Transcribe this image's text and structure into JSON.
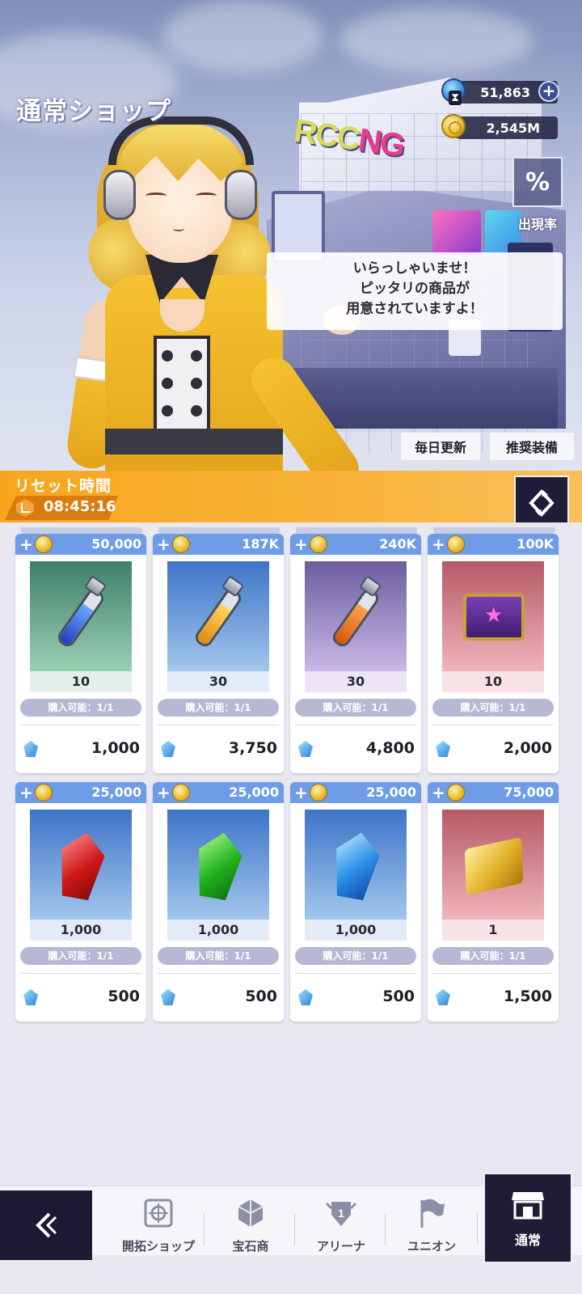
{
  "header": {
    "title": "通常ショップ",
    "gems": "51,863",
    "gold": "2,545M",
    "rate_icon": "%",
    "rate_label": "出現率",
    "speech": [
      "いらっしゃいませ！",
      "ピッタリの商品が",
      "用意されていますよ！"
    ],
    "tabs": [
      "毎日更新",
      "推奨装備"
    ]
  },
  "reset": {
    "label": "リセット時間",
    "time": "08:45:16"
  },
  "items": [
    {
      "top_price": "50,000",
      "qty": "10",
      "limit": "購入可能：1/1",
      "price": "1,000",
      "art": "vial-blue"
    },
    {
      "top_price": "187K",
      "qty": "30",
      "limit": "購入可能：1/1",
      "price": "3,750",
      "art": "vial-yellow"
    },
    {
      "top_price": "240K",
      "qty": "30",
      "limit": "購入可能：1/1",
      "price": "4,800",
      "art": "vial-orange"
    },
    {
      "top_price": "100K",
      "qty": "10",
      "limit": "購入可能：1/1",
      "price": "2,000",
      "art": "chest"
    },
    {
      "top_price": "25,000",
      "qty": "1,000",
      "limit": "購入可能：1/1",
      "price": "500",
      "art": "crystal-red"
    },
    {
      "top_price": "25,000",
      "qty": "1,000",
      "limit": "購入可能：1/1",
      "price": "500",
      "art": "crystal-green"
    },
    {
      "top_price": "25,000",
      "qty": "1,000",
      "limit": "購入可能：1/1",
      "price": "500",
      "art": "crystal-blue"
    },
    {
      "top_price": "75,000",
      "qty": "1",
      "limit": "購入可能：1/1",
      "price": "1,500",
      "art": "gold-block"
    }
  ],
  "nav": {
    "items": [
      "開拓ショップ",
      "宝石商",
      "アリーナ",
      "ユニオン"
    ],
    "active": "通常",
    "arena_badge": "1"
  },
  "colors": {
    "reset_bar": "#f7a51d",
    "card_header": "#6f9ce6",
    "dark_button": "#1f1d36",
    "limit_pill": "#b7b9d4"
  }
}
